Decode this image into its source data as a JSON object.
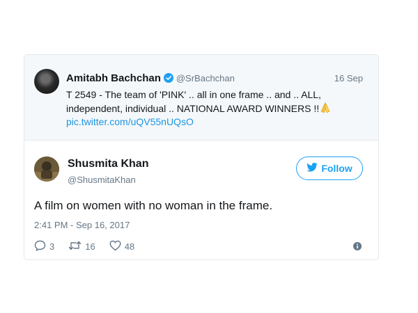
{
  "quoted_tweet": {
    "author_name": "Amitabh Bachchan",
    "author_handle": "@SrBachchan",
    "date": "16 Sep",
    "text": "T 2549 - The team of 'PINK' .. all in one frame .. and .. ALL, independent, individual .. NATIONAL AWARD WINNERS !!",
    "emoji_icon": "folded-hands-icon",
    "link": "pic.twitter.com/uQV55nUQsO"
  },
  "reply_tweet": {
    "author_name": "Shusmita Khan",
    "author_handle": "@ShusmitaKhan",
    "follow_label": "Follow",
    "text": "A film on women with no woman in the frame.",
    "timestamp": "2:41 PM - Sep 16, 2017",
    "replies": "3",
    "retweets": "16",
    "likes": "48"
  },
  "colors": {
    "accent": "#1da1f2",
    "link": "#1b95e0",
    "muted": "#657786",
    "border": "#e1e8ed",
    "quoted_bg": "#f5f8fa"
  }
}
